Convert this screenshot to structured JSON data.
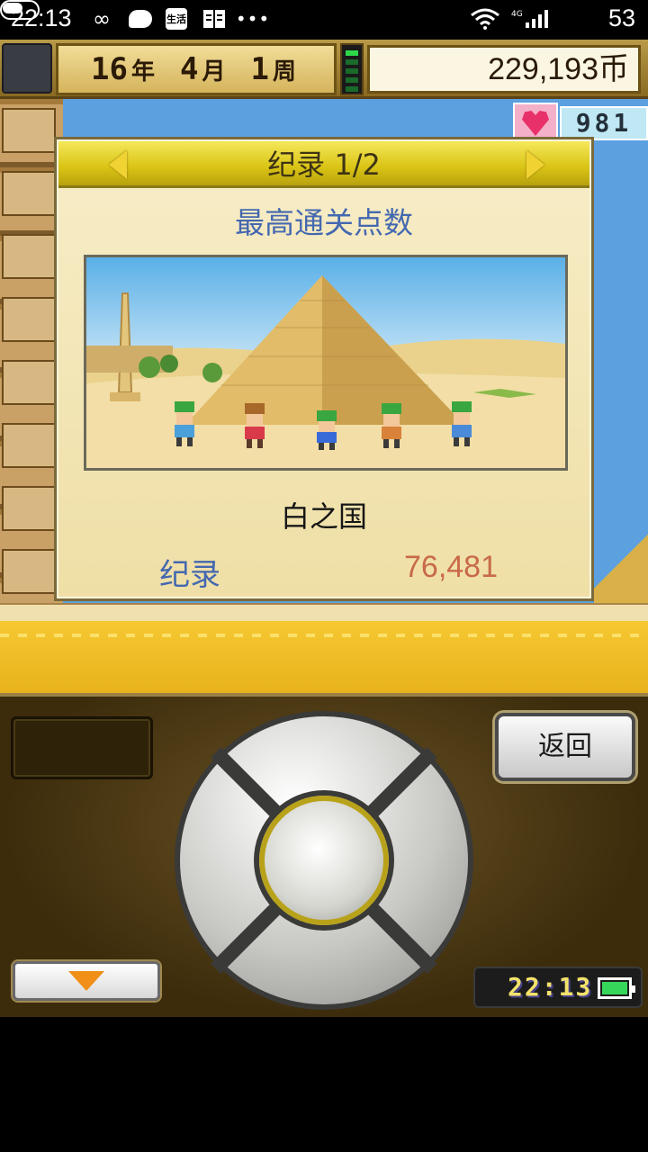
{
  "status_bar": {
    "time": "22:13",
    "battery_level": "53",
    "icons": [
      "infinity-icon",
      "chat-bubble-icon",
      "life-app-icon",
      "reader-icon",
      "more-dots-icon",
      "wifi-icon",
      "signal-4g-icon",
      "battery-toggle-icon"
    ],
    "life_app_label": "生活",
    "network_label": "4G",
    "more": "•••"
  },
  "top_bar": {
    "year": "16",
    "year_unit": "年",
    "month": "4",
    "month_unit": "月",
    "week": "1",
    "week_unit": "周",
    "money": "229,193币"
  },
  "hud": {
    "hearts_count": "981",
    "heart_icon": "heart-icon"
  },
  "dialog": {
    "title": "纪录 1/2",
    "subtitle": "最高通关点数",
    "country_name": "白之国",
    "record_label": "纪录",
    "record_value": "76,481"
  },
  "controller": {
    "back_label": "返回",
    "clock": "22:13"
  },
  "colors": {
    "accent_blue": "#4468b0",
    "record_value": "#c86a48",
    "header_yellow": "#d9c314",
    "sand": "#f6c832"
  }
}
